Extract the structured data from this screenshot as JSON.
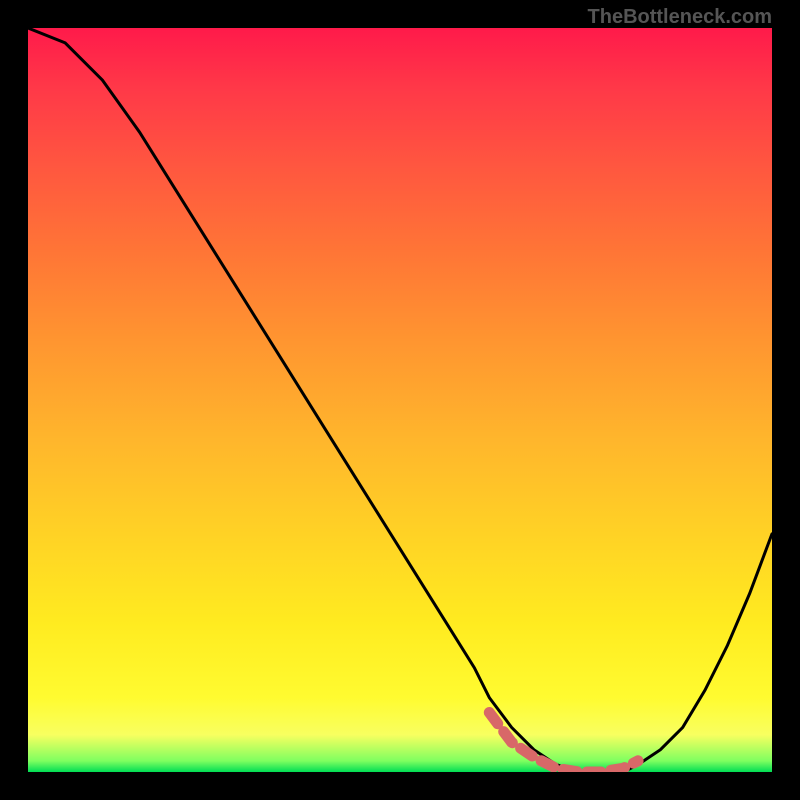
{
  "watermark": "TheBottleneck.com",
  "chart_data": {
    "type": "line",
    "title": "",
    "xlabel": "",
    "ylabel": "",
    "xlim": [
      0,
      100
    ],
    "ylim": [
      0,
      100
    ],
    "series": [
      {
        "name": "bottleneck-curve",
        "x": [
          0,
          5,
          10,
          15,
          20,
          25,
          30,
          35,
          40,
          45,
          50,
          55,
          60,
          62,
          65,
          68,
          71,
          74,
          77,
          80,
          82,
          85,
          88,
          91,
          94,
          97,
          100
        ],
        "y": [
          100,
          98,
          93,
          86,
          78,
          70,
          62,
          54,
          46,
          38,
          30,
          22,
          14,
          10,
          6,
          3,
          1,
          0,
          0,
          0,
          1,
          3,
          6,
          11,
          17,
          24,
          32
        ]
      }
    ],
    "marker_segment": {
      "name": "optimal-range-marker",
      "x": [
        62,
        65,
        68,
        71,
        74,
        77,
        80,
        82
      ],
      "y": [
        8,
        4,
        2,
        0.5,
        0,
        0,
        0.5,
        1.5
      ],
      "color": "#d86868"
    },
    "gradient_stops": [
      {
        "pos": 0,
        "color": "#ff1a4a"
      },
      {
        "pos": 55,
        "color": "#ffb52c"
      },
      {
        "pos": 90,
        "color": "#fffb30"
      },
      {
        "pos": 100,
        "color": "#00dd55"
      }
    ]
  }
}
